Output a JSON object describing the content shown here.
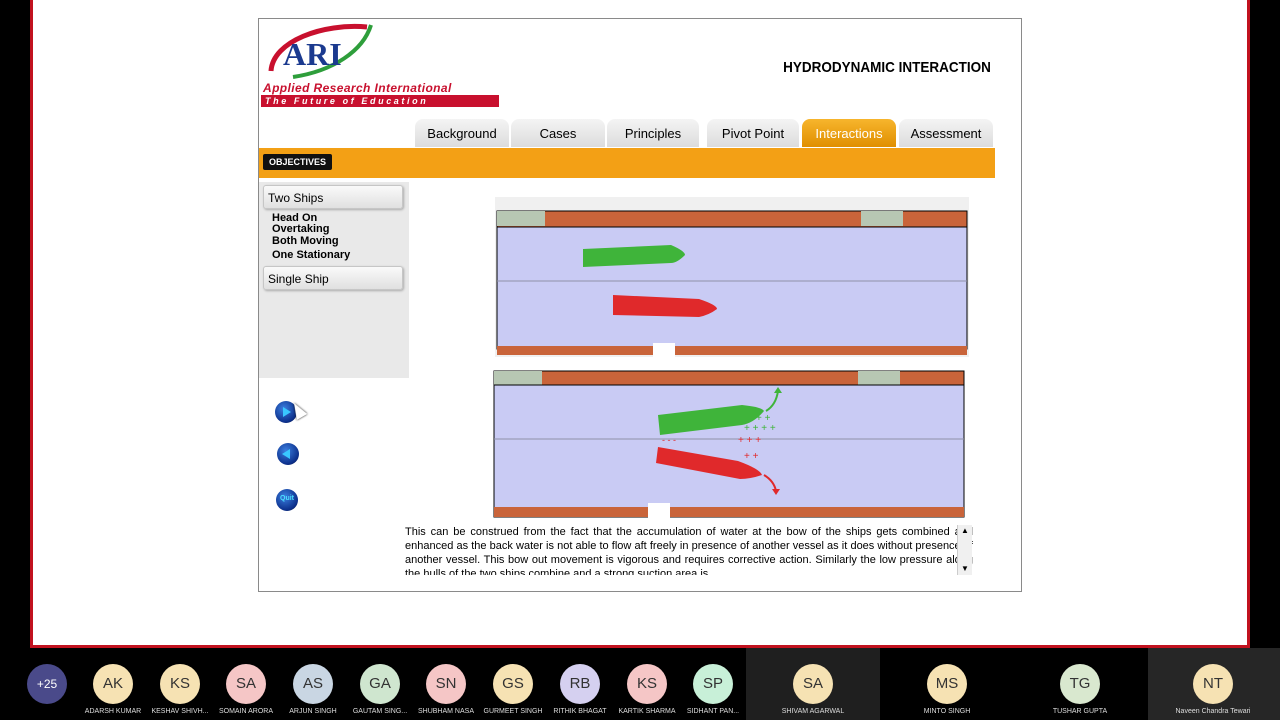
{
  "app": {
    "logo_text": "ARI",
    "logo_subtitle": "Applied Research International",
    "logo_tagline": "The Future of Education",
    "title": "HYDRODYNAMIC INTERACTION"
  },
  "tabs": [
    {
      "label": "Background",
      "active": false
    },
    {
      "label": "Cases",
      "active": false
    },
    {
      "label": "Principles",
      "active": false
    },
    {
      "label": "Pivot Point",
      "active": false
    },
    {
      "label": "Interactions",
      "active": true
    },
    {
      "label": "Assessment",
      "active": false
    }
  ],
  "objectives_label": "OBJECTIVES",
  "sidebar": {
    "two_ships_label": "Two Ships",
    "sub_items": [
      "Head On",
      "Overtaking",
      "Both Moving",
      "One Stationary"
    ],
    "single_ship_label": "Single Ship"
  },
  "nav_controls": {
    "next": "next-icon",
    "back": "back-icon",
    "quit": "Quit"
  },
  "description": "This can be construed from the fact that the accumulation of water at the bow of the ships gets combined and enhanced as the back water is not able to flow aft freely in presence of another vessel as it does without presence of another vessel.  This bow out movement is vigorous and requires corrective action. Similarly the low pressure along the hulls of the two ships combine and a strong suction area is",
  "colors": {
    "accent": "#f3a015",
    "active_tab": "#e99a0a",
    "water": "#c9cbf4",
    "bank": "#c9643a",
    "green_ship": "#3fb43a",
    "red_ship": "#e0292b",
    "frame_border": "#c1121f"
  },
  "participants": {
    "overflow_count": "+25",
    "list": [
      {
        "initials": "AK",
        "name": "ADARSH KUMAR",
        "color": "#f6e2b3"
      },
      {
        "initials": "KS",
        "name": "KESHAV SHIVH...",
        "color": "#f6e2b3"
      },
      {
        "initials": "SA",
        "name": "SOMAIN ARORA",
        "color": "#f5c6c6"
      },
      {
        "initials": "AS",
        "name": "ARJUN SINGH",
        "color": "#c9d6e3"
      },
      {
        "initials": "GA",
        "name": "GAUTAM SING...",
        "color": "#cfe6cf"
      },
      {
        "initials": "SN",
        "name": "SHUBHAM NASA",
        "color": "#f5c6c6"
      },
      {
        "initials": "GS",
        "name": "GURMEET SINGH",
        "color": "#f6e2b3"
      },
      {
        "initials": "RB",
        "name": "RITHIK BHAGAT",
        "color": "#d5d0f0"
      },
      {
        "initials": "KS",
        "name": "KARTIK SHARMA",
        "color": "#f5c6c6"
      },
      {
        "initials": "SP",
        "name": "SIDHANT PAN...",
        "color": "#c8f0d8"
      }
    ],
    "large": [
      {
        "initials": "SA",
        "name": "SHIVAM AGARWAL",
        "color": "#f6e2b3"
      },
      {
        "initials": "MS",
        "name": "MINTO SINGH",
        "color": "#f6e2b3"
      },
      {
        "initials": "TG",
        "name": "TUSHAR GUPTA",
        "color": "#d9e8cf"
      },
      {
        "initials": "NT",
        "name": "Naveen Chandra Tewari",
        "color": "#f6e2b3"
      }
    ]
  }
}
